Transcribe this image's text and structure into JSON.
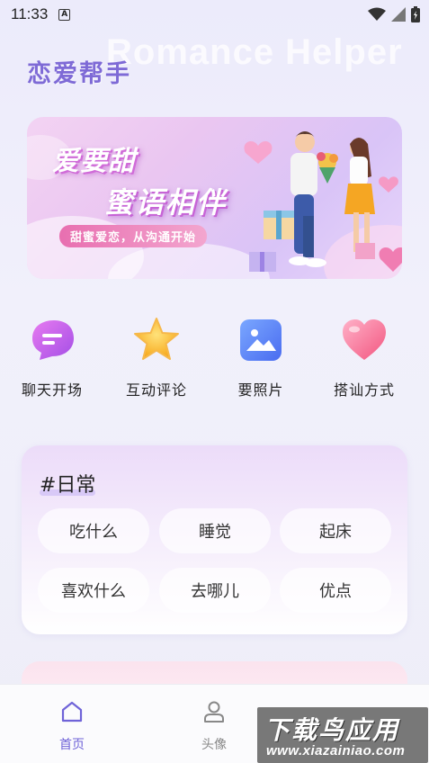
{
  "status_bar": {
    "time": "11:33",
    "notification_badge": "A"
  },
  "header": {
    "title": "恋爱帮手",
    "watermark": "Romance Helper"
  },
  "banner": {
    "headline_line1": "爱要甜",
    "headline_line2": "蜜语相伴",
    "subtitle": "甜蜜爱恋，从沟通开始"
  },
  "shortcuts": [
    {
      "label": "聊天开场",
      "icon": "chat-bubble-icon"
    },
    {
      "label": "互动评论",
      "icon": "star-icon"
    },
    {
      "label": "要照片",
      "icon": "image-icon"
    },
    {
      "label": "搭讪方式",
      "icon": "heart-icon"
    }
  ],
  "topic_card": {
    "title": "#日常",
    "tags": [
      "吃什么",
      "睡觉",
      "起床",
      "喜欢什么",
      "去哪儿",
      "优点"
    ]
  },
  "tabbar": {
    "tabs": [
      {
        "label": "首页",
        "icon": "home-icon",
        "active": true
      },
      {
        "label": "头像",
        "icon": "user-icon",
        "active": false
      }
    ]
  },
  "site_watermark": {
    "main": "下载鸟应用",
    "url": "www.xiazainiao.com"
  },
  "colors": {
    "accent": "#7e6ad6",
    "tab_active": "#6f63d8",
    "tab_inactive": "#888888"
  }
}
